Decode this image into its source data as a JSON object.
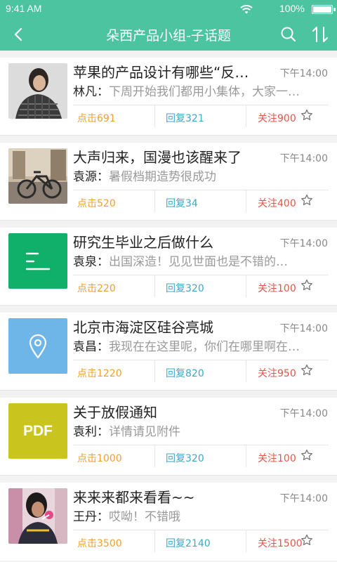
{
  "status_bar": {
    "time": "9:41 AM",
    "battery": "100%",
    "icons": [
      "wifi-icon",
      "battery-icon"
    ]
  },
  "header": {
    "title": "朵西产品小组-子话题",
    "icons": [
      "back-icon",
      "search-icon",
      "sort-icon"
    ]
  },
  "colors": {
    "accent": "#4dc4a0",
    "click": "#f0a030",
    "reply": "#3aa9cc",
    "follow": "#e2564a",
    "thumb_green": "#10b06a",
    "thumb_blue": "#6fb6e8",
    "thumb_pdf": "#c9c51e"
  },
  "posts": [
    {
      "title": "苹果的产品设计有哪些“反…",
      "time": "下午14:00",
      "author": "林凡",
      "colon": "：",
      "preview": "下周开始我们都用小集体，大家一…",
      "clicks": "点击691",
      "replies": "回复321",
      "follows": "关注900",
      "thumb": "photo-woman-portrait"
    },
    {
      "title": "大声归来，国漫也该醒来了",
      "time": "下午14:00",
      "author": "袁源",
      "colon": "：",
      "preview": "暑假档期造势很成功",
      "clicks": "点击520",
      "replies": "回复34",
      "follows": "关注400",
      "thumb": "photo-bicycle-street"
    },
    {
      "title": "研究生毕业之后做什么",
      "time": "下午14:00",
      "author": "袁泉",
      "colon": "：",
      "preview": "出国深造！见见世面也是不错的…",
      "clicks": "点击220",
      "replies": "回复320",
      "follows": "关注100",
      "thumb": "text-document-icon"
    },
    {
      "title": "北京市海淀区硅谷亮城",
      "time": "下午14:00",
      "author": "袁昌",
      "colon": "：",
      "preview": "我现在在这里呢，你们在哪里啊在…",
      "clicks": "点击1220",
      "replies": "回复820",
      "follows": "关注950",
      "thumb": "location-pin-icon"
    },
    {
      "title": "关于放假通知",
      "time": "下午14:00",
      "author": "袁利",
      "colon": "：",
      "preview": "详情请见附件",
      "clicks": "点击1000",
      "replies": "回复320",
      "follows": "关注100",
      "thumb": "pdf-icon",
      "thumb_text": "PDF"
    },
    {
      "title": "来来来都来看看~~",
      "time": "下午14:00",
      "author": "王丹",
      "colon": "：",
      "preview": "哎呦！不错哦",
      "clicks": "点击3500",
      "replies": "回复2140",
      "follows": "关注1500",
      "thumb": "photo-woman-lollipop"
    }
  ]
}
